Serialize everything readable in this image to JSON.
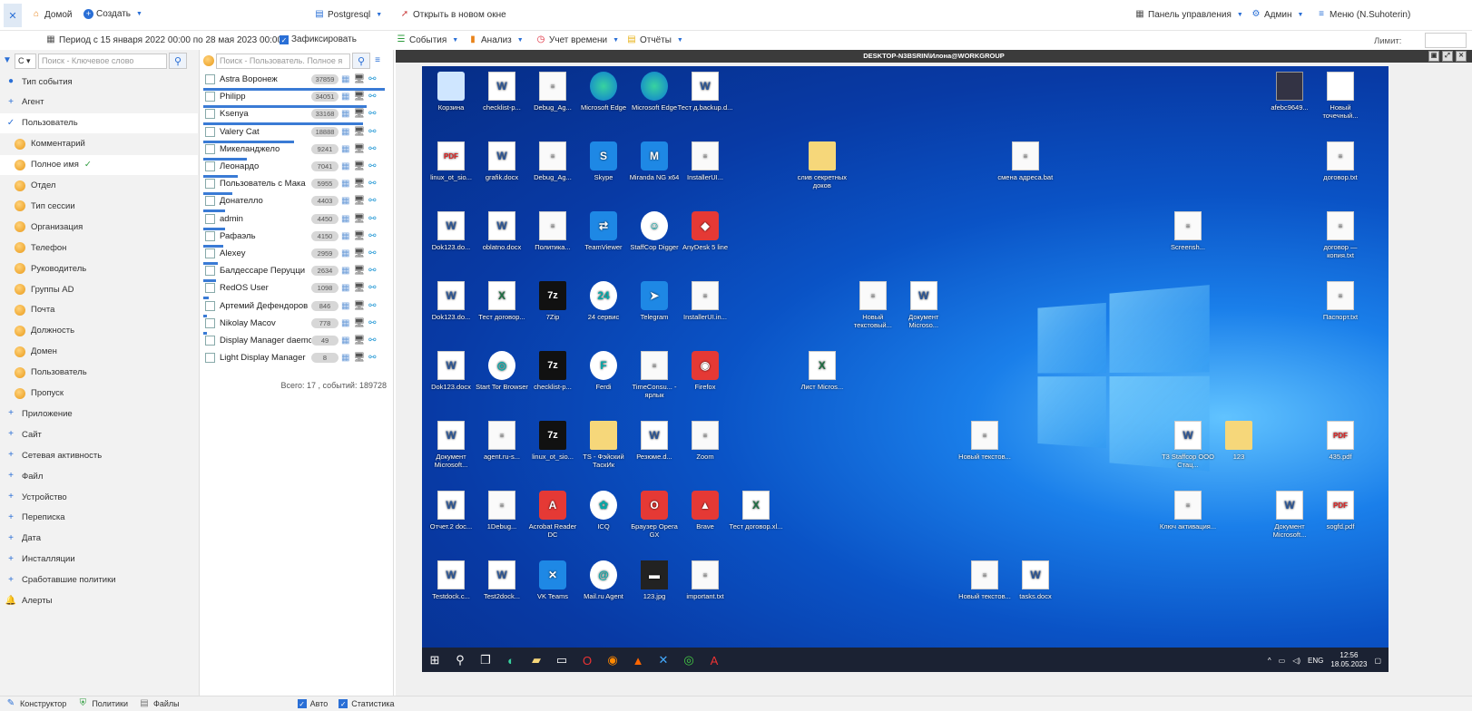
{
  "topbar": {
    "home": "Домой",
    "create": "Создать",
    "db": "Postgresql",
    "open_new_window": "Открыть в новом окне",
    "control_panel": "Панель управления",
    "admin": "Админ",
    "menu": "Меню (N.Suhoterin)"
  },
  "bar2": {
    "period": "Период с 15 января 2022 00:00 по 28 мая 2023 00:00",
    "fix_label": "Зафиксировать",
    "events": "События",
    "analysis": "Анализ",
    "time_tracking": "Учет времени",
    "reports": "Отчёты",
    "limit_label": "Лимит:"
  },
  "filters": {
    "search_placeholder": "Поиск - Ключевое слово",
    "items": [
      {
        "label": "Тип события",
        "kind": "root",
        "icon": "tag-icon"
      },
      {
        "label": "Агент",
        "kind": "plus"
      },
      {
        "label": "Пользователь",
        "kind": "check",
        "selected": true
      },
      {
        "label": "Комментарий",
        "kind": "sub"
      },
      {
        "label": "Полное имя",
        "kind": "sub",
        "selected": true
      },
      {
        "label": "Отдел",
        "kind": "sub"
      },
      {
        "label": "Тип сессии",
        "kind": "sub"
      },
      {
        "label": "Организация",
        "kind": "sub"
      },
      {
        "label": "Телефон",
        "kind": "sub"
      },
      {
        "label": "Руководитель",
        "kind": "sub"
      },
      {
        "label": "Группы AD",
        "kind": "sub"
      },
      {
        "label": "Почта",
        "kind": "sub"
      },
      {
        "label": "Должность",
        "kind": "sub"
      },
      {
        "label": "Домен",
        "kind": "sub"
      },
      {
        "label": "Пользователь",
        "kind": "sub"
      },
      {
        "label": "Пропуск",
        "kind": "sub"
      },
      {
        "label": "Приложение",
        "kind": "plus"
      },
      {
        "label": "Сайт",
        "kind": "plus"
      },
      {
        "label": "Сетевая активность",
        "kind": "plus"
      },
      {
        "label": "Файл",
        "kind": "plus"
      },
      {
        "label": "Устройство",
        "kind": "plus"
      },
      {
        "label": "Переписка",
        "kind": "plus"
      },
      {
        "label": "Дата",
        "kind": "plus"
      },
      {
        "label": "Инсталляции",
        "kind": "plus"
      },
      {
        "label": "Сработавшие политики",
        "kind": "plus"
      },
      {
        "label": "Алерты",
        "kind": "alert"
      }
    ]
  },
  "users": {
    "search_placeholder": "Поиск - Пользователь. Полное я",
    "rows": [
      {
        "name": "Astra Воронеж",
        "count": "37859",
        "bar": 1.0
      },
      {
        "name": "Philipp",
        "count": "34051",
        "bar": 0.9
      },
      {
        "name": "Ksenya",
        "count": "33168",
        "bar": 0.88
      },
      {
        "name": "Valery Cat",
        "count": "18888",
        "bar": 0.5
      },
      {
        "name": "Микеланджело",
        "count": "9241",
        "bar": 0.24
      },
      {
        "name": "Леонардо",
        "count": "7041",
        "bar": 0.19
      },
      {
        "name": "Пользователь с Мака",
        "count": "5955",
        "bar": 0.16
      },
      {
        "name": "Донателло",
        "count": "4403",
        "bar": 0.12
      },
      {
        "name": "admin",
        "count": "4450",
        "bar": 0.12
      },
      {
        "name": "Рафаэль",
        "count": "4150",
        "bar": 0.11
      },
      {
        "name": "Alexey",
        "count": "2959",
        "bar": 0.08
      },
      {
        "name": "Балдессаре Перуцци",
        "count": "2634",
        "bar": 0.07
      },
      {
        "name": "RedOS User",
        "count": "1098",
        "bar": 0.03
      },
      {
        "name": "Артемий Дефендоров",
        "count": "846",
        "bar": 0.02
      },
      {
        "name": "Nikolay Macov",
        "count": "778",
        "bar": 0.02
      },
      {
        "name": "Display Manager daemon",
        "count": "49",
        "bar": 0.0
      },
      {
        "name": "Light Display Manager",
        "count": "8",
        "bar": 0.0
      }
    ],
    "total": "Всего: 17 , событий: 189728"
  },
  "view": {
    "title": "DESKTOP-N3BSRIN\\Илона@WORKGROUP"
  },
  "desktop": {
    "icons": [
      {
        "label": "Корзина",
        "type": "bin"
      },
      {
        "label": "checklist-p...",
        "type": "word"
      },
      {
        "label": "Debug_Ag...",
        "type": "doc"
      },
      {
        "label": "Microsoft Edge",
        "type": "edge"
      },
      {
        "label": "Microsoft Edge",
        "type": "edge"
      },
      {
        "label": "Тест д.backup.d...",
        "type": "word"
      },
      {
        "label": "linux_ot_sio...",
        "type": "pdf"
      },
      {
        "label": "grafik.docx",
        "type": "word"
      },
      {
        "label": "Debug_Ag...",
        "type": "doc"
      },
      {
        "label": "Skype",
        "type": "blue",
        "glyph": "S"
      },
      {
        "label": "Miranda NG x64",
        "type": "blue",
        "glyph": "M"
      },
      {
        "label": "InstallerUI...",
        "type": "doc"
      },
      {
        "label": "Dok123.do...",
        "type": "word"
      },
      {
        "label": "oblatno.docx",
        "type": "word"
      },
      {
        "label": "Политика...",
        "type": "doc"
      },
      {
        "label": "TeamViewer",
        "type": "blue",
        "glyph": "⇄"
      },
      {
        "label": "StaffCop Digger",
        "type": "round",
        "glyph": "☺"
      },
      {
        "label": "AnyDesk 5 line",
        "type": "red",
        "glyph": "◆"
      },
      {
        "label": "Dok123.do...",
        "type": "word"
      },
      {
        "label": "Тест договор...",
        "type": "xls"
      },
      {
        "label": "7Zip",
        "type": "7z"
      },
      {
        "label": "24 сервис",
        "type": "round",
        "glyph": "24"
      },
      {
        "label": "Telegram",
        "type": "blue",
        "glyph": "➤"
      },
      {
        "label": "InstallerUI.in...",
        "type": "doc"
      },
      {
        "label": "Dok123.docx",
        "type": "word"
      },
      {
        "label": "Start Tor Browser",
        "type": "round",
        "glyph": "◎"
      },
      {
        "label": "checklist-p...",
        "type": "7z"
      },
      {
        "label": "Ferdi",
        "type": "round",
        "glyph": "F"
      },
      {
        "label": "TimeConsu... - ярлык",
        "type": "doc"
      },
      {
        "label": "Firefox",
        "type": "red",
        "glyph": "◉"
      },
      {
        "label": "Документ Microsoft...",
        "type": "word"
      },
      {
        "label": "agent.ru-s...",
        "type": "doc"
      },
      {
        "label": "linux_ot_sio...",
        "type": "7z"
      },
      {
        "label": "TS - Фэйский ТаскИк",
        "type": "fold"
      },
      {
        "label": "Резюме.d...",
        "type": "word"
      },
      {
        "label": "Zoom",
        "type": "doc"
      },
      {
        "label": "Отчет.2 doc...",
        "type": "word"
      },
      {
        "label": "1Debug...",
        "type": "doc"
      },
      {
        "label": "Acrobat Reader DC",
        "type": "red",
        "glyph": "A"
      },
      {
        "label": "ICQ",
        "type": "round",
        "glyph": "✿"
      },
      {
        "label": "Браузер Opera GX",
        "type": "red",
        "glyph": "O"
      },
      {
        "label": "Brave",
        "type": "red",
        "glyph": "▲"
      },
      {
        "label": "Тест договор.xl...",
        "type": "xls"
      },
      {
        "label": "Testdock.c...",
        "type": "word"
      },
      {
        "label": "Test2dock...",
        "type": "word"
      },
      {
        "label": "VK Teams",
        "type": "blue",
        "glyph": "✕"
      },
      {
        "label": "Mail.ru Agent",
        "type": "round",
        "glyph": "@"
      },
      {
        "label": "123.jpg",
        "type": "dark",
        "glyph": "▬"
      },
      {
        "label": "important.txt",
        "type": "doc"
      },
      {
        "label": "Новый текстовый...",
        "type": "doc"
      },
      {
        "label": "Документ Microso...",
        "type": "word"
      },
      {
        "label": "Лист Micros...",
        "type": "xls"
      },
      {
        "label": "слив секретных доков",
        "type": "fold"
      },
      {
        "label": "смена адреса.bat",
        "type": "doc"
      },
      {
        "label": "Новый текстов...",
        "type": "doc"
      },
      {
        "label": "Новый текстов...",
        "type": "doc"
      },
      {
        "label": "tasks.docx",
        "type": "word"
      },
      {
        "label": "Screensh...",
        "type": "doc"
      },
      {
        "label": "T3 Staffcop ООО Стац...",
        "type": "word"
      },
      {
        "label": "123",
        "type": "fold"
      },
      {
        "label": "Ключ активация...",
        "type": "doc"
      },
      {
        "label": "Документ Microsoft...",
        "type": "word"
      },
      {
        "label": "sogfd.pdf",
        "type": "pdf"
      },
      {
        "label": "afebc9649...",
        "type": "photo"
      },
      {
        "label": "Новый точечный...",
        "type": "env"
      },
      {
        "label": "договор.txt",
        "type": "doc"
      },
      {
        "label": "договор — копия.txt",
        "type": "doc"
      },
      {
        "label": "Паспорт.txt",
        "type": "doc"
      },
      {
        "label": "435.pdf",
        "type": "pdf"
      }
    ]
  },
  "taskbar": {
    "lang": "ENG",
    "time": "12:56",
    "date": "18.05.2023"
  },
  "bottom": {
    "constructor": "Конструктор",
    "policies": "Политики",
    "files": "Файлы",
    "auto": "Авто",
    "stats": "Статистика"
  }
}
